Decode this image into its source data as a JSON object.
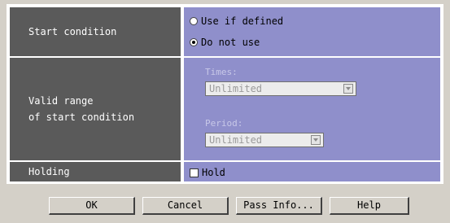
{
  "start_condition": {
    "label": "Start condition",
    "options": [
      {
        "label": "Use if defined",
        "selected": false
      },
      {
        "label": "Do not use",
        "selected": true
      }
    ]
  },
  "valid_range": {
    "label_line1": "Valid range",
    "label_line2": "of start condition",
    "times_label": "Times:",
    "times_value": "Unlimited",
    "period_label": "Period:",
    "period_value": "Unlimited",
    "disabled": true
  },
  "holding": {
    "label": "Holding",
    "checkbox_label": "Hold",
    "checked": false
  },
  "buttons": {
    "ok": "OK",
    "cancel": "Cancel",
    "pass_info": "Pass Info...",
    "help": "Help"
  },
  "colors": {
    "label_bg": "#5a5a5a",
    "value_bg": "#8f8fcb",
    "dialog_bg": "#d4d0c8"
  }
}
